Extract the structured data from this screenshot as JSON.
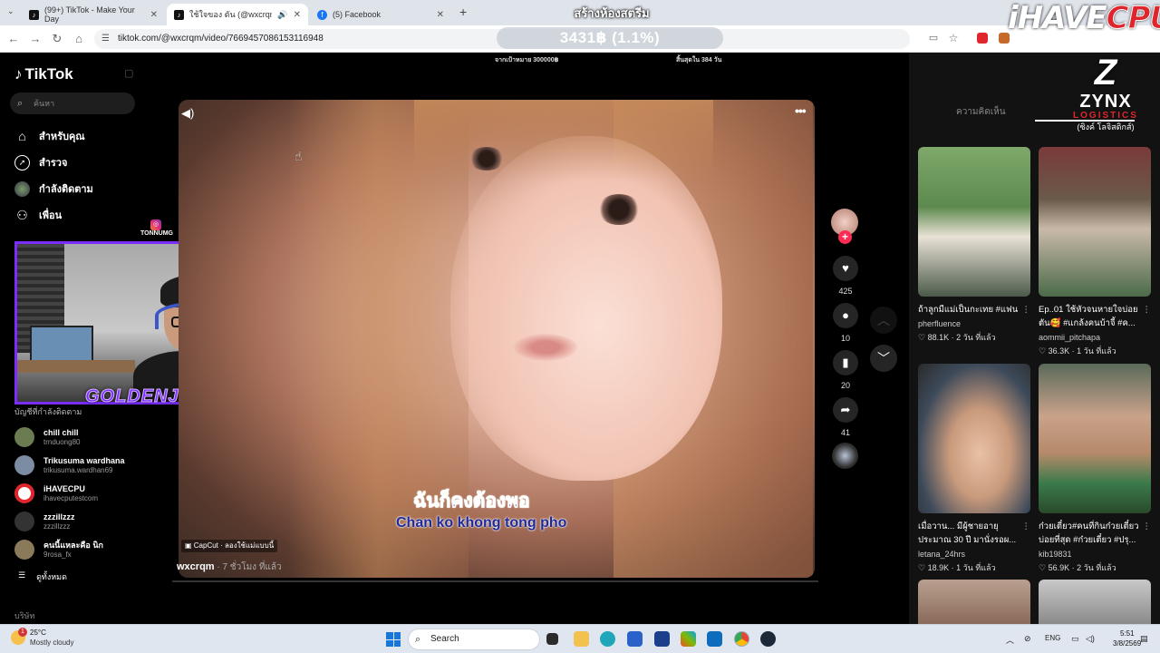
{
  "browser": {
    "tabs": [
      {
        "title": "(99+) TikTok - Make Your Day",
        "icon": "tiktok-icon"
      },
      {
        "title": "ใช้ใจของ ตัน (@wxcrqm) wi",
        "icon": "tiktok-icon"
      },
      {
        "title": "(5) Facebook",
        "icon": "facebook-icon"
      }
    ],
    "new_tab": "+",
    "url": "tiktok.com/@wxcrqm/video/7669457086153116948"
  },
  "stream_overlay": {
    "title": "สร้างห้องสตรีม",
    "donation": "3431฿ (1.1%)",
    "goal_left": "จากเป้าหมาย 300000฿",
    "goal_right": "สิ้นสุดใน 384 วัน",
    "brand_prefix": "iHAVE",
    "brand_suffix": "CPU",
    "sponsor_mark": "Z",
    "sponsor_name": "ZYNX",
    "sponsor_sub": "LOGISTICS",
    "sponsor_thai": "(ซิงค์ โลจิสติกส์)",
    "cam_name": "TONNUMG",
    "cam_signature": "GOLDENJET"
  },
  "sidebar": {
    "logo": "TikTok",
    "search_placeholder": "ค้นหา",
    "items": [
      {
        "label": "สำหรับคุณ",
        "icon": "home-icon"
      },
      {
        "label": "สำรวจ",
        "icon": "compass-icon"
      },
      {
        "label": "กำลังติดตาม",
        "icon": "following-avatar-icon"
      },
      {
        "label": "เพื่อน",
        "icon": "friends-icon"
      }
    ],
    "following_title": "บัญชีที่กำลังติดตาม",
    "accounts": [
      {
        "name": "chill chill",
        "handle": "trnduong80",
        "color": "#6b7b52"
      },
      {
        "name": "Trikusuma wardhana",
        "handle": "trikusuma.wardhan69",
        "color": "#7c8da3"
      },
      {
        "name": "iHAVECPU",
        "handle": "ihavecputestcom",
        "color": "#e0262d"
      },
      {
        "name": "zzzillzzz",
        "handle": "zzzillzzz",
        "color": "#333333"
      },
      {
        "name": "คนนี้แหละคือ นิก",
        "handle": "9rosa_fx",
        "color": "#8a7a5a"
      }
    ],
    "see_all": "ดูทั้งหมด",
    "company": "บริษัท"
  },
  "video": {
    "subtitle_thai": "ฉันก็คงต้องพอ",
    "subtitle_roman": "Chan ko khong tong pho",
    "capcut": "CapCut · ลองใช้แม่แบบนี้",
    "author": "wxcrqm",
    "time": " · 7 ชั่วโมง ที่แล้ว",
    "progress": 0.0
  },
  "actions": {
    "likes": "425",
    "comments": "10",
    "saves": "20",
    "shares": "41"
  },
  "right_pane": {
    "tab_comments": "ความคิดเห็น",
    "cards": [
      {
        "caption": "ถ้าลูกมีแม่เป็นกะเทย #แฟน",
        "user": "pherfluence",
        "views": "88.1K",
        "age": "2 วัน ที่แล้ว"
      },
      {
        "caption": "Ep..01 ใช้หัวจนหายใจบ่อย",
        "caption2": "ตัน🥰 #แกล้งคนบ้าจี้ #ค...",
        "user": "aommii_pitchapa",
        "views": "36.3K",
        "age": "1 วัน ที่แล้ว"
      },
      {
        "caption": "เมื่อวาน... มีผู้ชายอายุ",
        "caption2": "ประมาณ 30 ปี มานั่งรอผ...",
        "user": "letana_24hrs",
        "views": "18.9K",
        "age": "1 วัน ที่แล้ว"
      },
      {
        "caption": "ก๋วยเตี๋ยว#คนที่กินก๋วยเตี๋ยว",
        "caption2": "บ่อยที่สุด #ก๋วยเตี๋ยว #ปรุ...",
        "user": "kib19831",
        "views": "56.9K",
        "age": "2 วัน ที่แล้ว"
      }
    ]
  },
  "taskbar": {
    "temp": "25°C",
    "weather": "Mostly cloudy",
    "weather_badge": "1",
    "search": "Search",
    "lang": "ENG",
    "time": "5:51",
    "date": "3/8/2569"
  }
}
